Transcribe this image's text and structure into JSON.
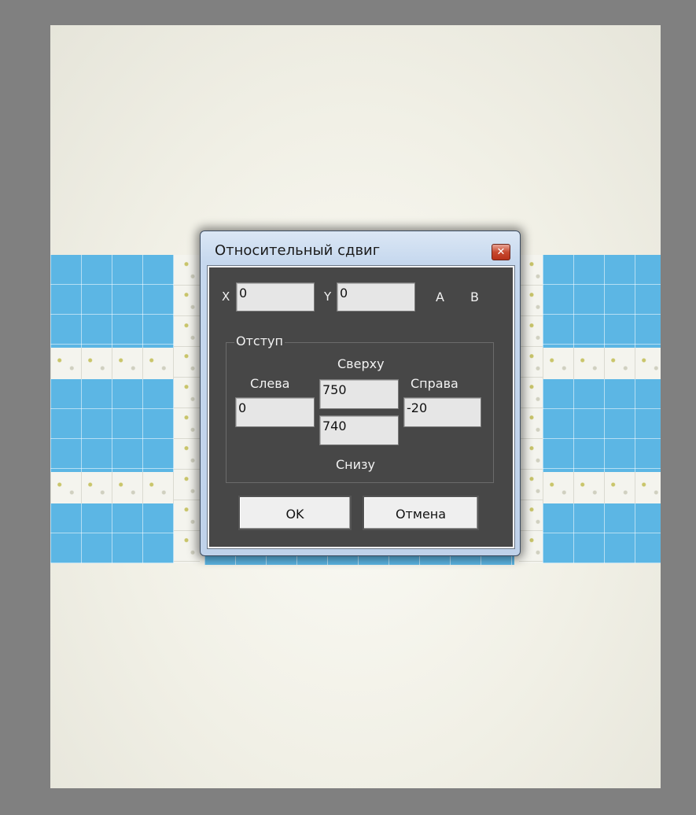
{
  "dialog": {
    "title": "Относительный сдвиг",
    "close_glyph": "✕",
    "x_label": "X",
    "x_value": "0",
    "y_label": "Y",
    "y_value": "0",
    "a_label": "A",
    "b_label": "B",
    "group_label": "Отступ",
    "left_label": "Слева",
    "left_value": "0",
    "top_label": "Сверху",
    "top_value": "750",
    "right_label": "Справа",
    "right_value": "-20",
    "bottom_value": "740",
    "bottom_label": "Снизу",
    "ok_label": "OK",
    "cancel_label": "Отмена"
  },
  "colors": {
    "outer_bg": "#808080",
    "canvas_bg": "#f1f0e6",
    "tile_blue": "#5cb6e4",
    "dialog_client": "#474747"
  }
}
